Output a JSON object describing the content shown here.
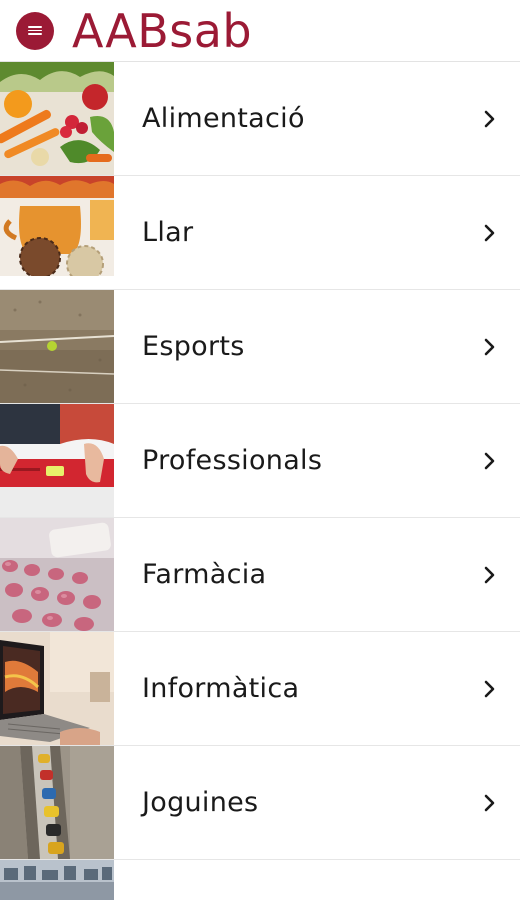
{
  "app": {
    "title": "AABsab",
    "brand_color": "#9b1a35",
    "menu_icon": "hamburger-menu-icon"
  },
  "categories": [
    {
      "label": "Alimentació",
      "image": "vegetables-photo"
    },
    {
      "label": "Llar",
      "image": "home-decor-photo"
    },
    {
      "label": "Esports",
      "image": "tennis-court-photo"
    },
    {
      "label": "Professionals",
      "image": "spirit-level-photo"
    },
    {
      "label": "Farmàcia",
      "image": "pills-blister-photo"
    },
    {
      "label": "Informàtica",
      "image": "laptop-photo"
    },
    {
      "label": "Joguines",
      "image": "toy-cars-photo"
    }
  ],
  "chevron_icon": "chevron-right-icon"
}
